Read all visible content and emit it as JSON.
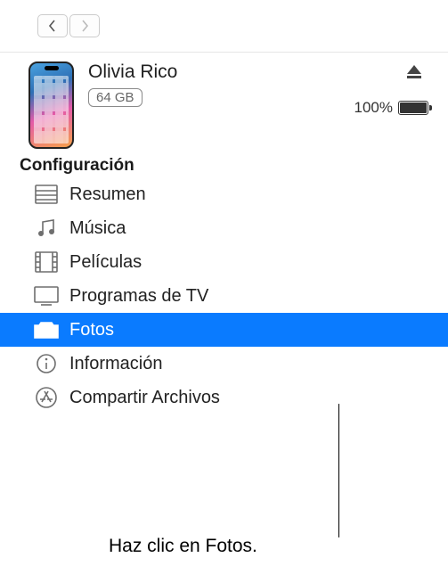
{
  "device": {
    "name": "Olivia Rico",
    "storage": "64 GB",
    "battery_percent": "100%"
  },
  "section_title": "Configuración",
  "sidebar": {
    "items": [
      {
        "label": "Resumen"
      },
      {
        "label": "Música"
      },
      {
        "label": "Películas"
      },
      {
        "label": "Programas de TV"
      },
      {
        "label": "Fotos"
      },
      {
        "label": "Información"
      },
      {
        "label": "Compartir Archivos"
      }
    ]
  },
  "callout": "Haz clic en Fotos."
}
